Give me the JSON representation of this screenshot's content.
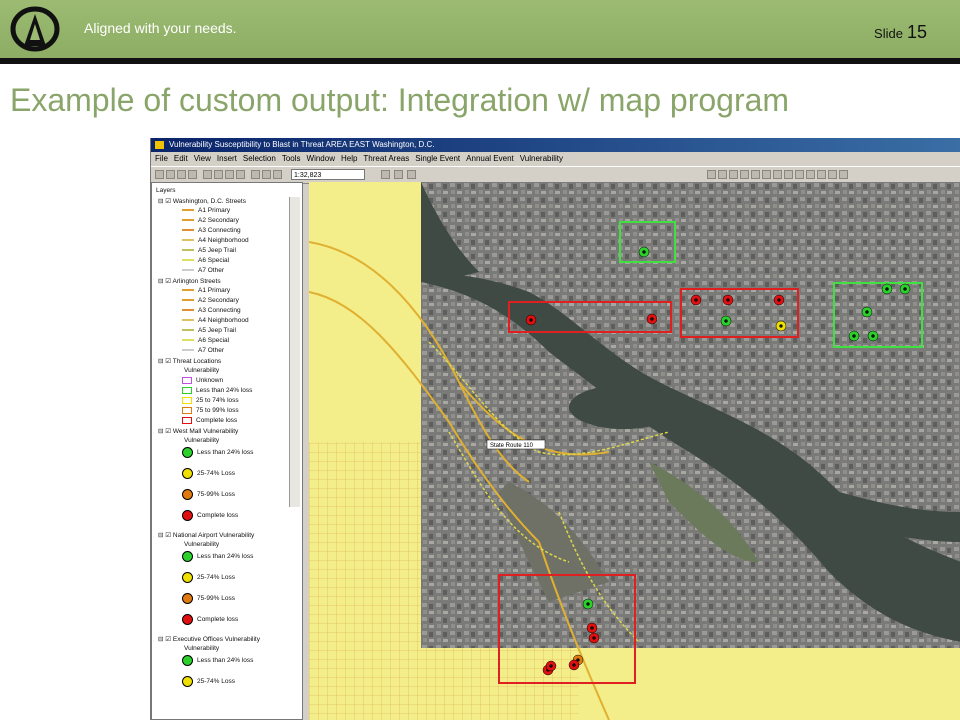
{
  "slide": {
    "tagline": "Aligned with your needs.",
    "slide_label": "Slide",
    "slide_number": "15",
    "title": "Example of custom output: Integration w/ map program"
  },
  "gis": {
    "window_title": "Vulnerability Susceptibility to Blast in Threat AREA EAST Washington, D.C.",
    "menu": [
      "File",
      "Edit",
      "View",
      "Insert",
      "Selection",
      "Tools",
      "Window",
      "Help",
      "Threat Areas",
      "Single Event",
      "Annual Event",
      "Vulnerability"
    ],
    "scale_value": "1:32,823",
    "toc": {
      "root": "Layers",
      "groups": [
        {
          "name": "Washington, D.C. Streets",
          "items": [
            "A1 Primary",
            "A2 Secondary",
            "A3 Connecting",
            "A4 Neighborhood",
            "A5 Jeep Trail",
            "A6 Special",
            "A7 Other"
          ]
        },
        {
          "name": "Arlington Streets",
          "items": [
            "A1 Primary",
            "A2 Secondary",
            "A3 Connecting",
            "A4 Neighborhood",
            "A5 Jeep Trail",
            "A6 Special",
            "A7 Other"
          ]
        },
        {
          "name": "Threat Locations",
          "sub": "Vulnerability",
          "items": [
            "Unknown",
            "Less than 24% loss",
            "25 to 74% loss",
            "75 to 99% loss",
            "Complete loss"
          ]
        },
        {
          "name": "West Mall Vulnerability",
          "sub": "Vulnerability",
          "items": [
            "Less than 24% loss",
            "25-74% Loss",
            "75-99% Loss",
            "Complete loss"
          ]
        },
        {
          "name": "National Airport Vulnerability",
          "sub": "Vulnerability",
          "items": [
            "Less than 24% loss",
            "25-74% Loss",
            "75-99% Loss",
            "Complete loss"
          ]
        },
        {
          "name": "Executive Offices Vulnerability",
          "sub": "Vulnerability",
          "items": [
            "Less than 24% loss",
            "25-74% Loss"
          ]
        }
      ]
    },
    "map_label": "State Route 110",
    "colors": {
      "green": "#2bd02b",
      "yellow": "#f0e000",
      "orange": "#e07a10",
      "red": "#e01010",
      "box_red": "#e02020",
      "box_green": "#40e040"
    }
  }
}
